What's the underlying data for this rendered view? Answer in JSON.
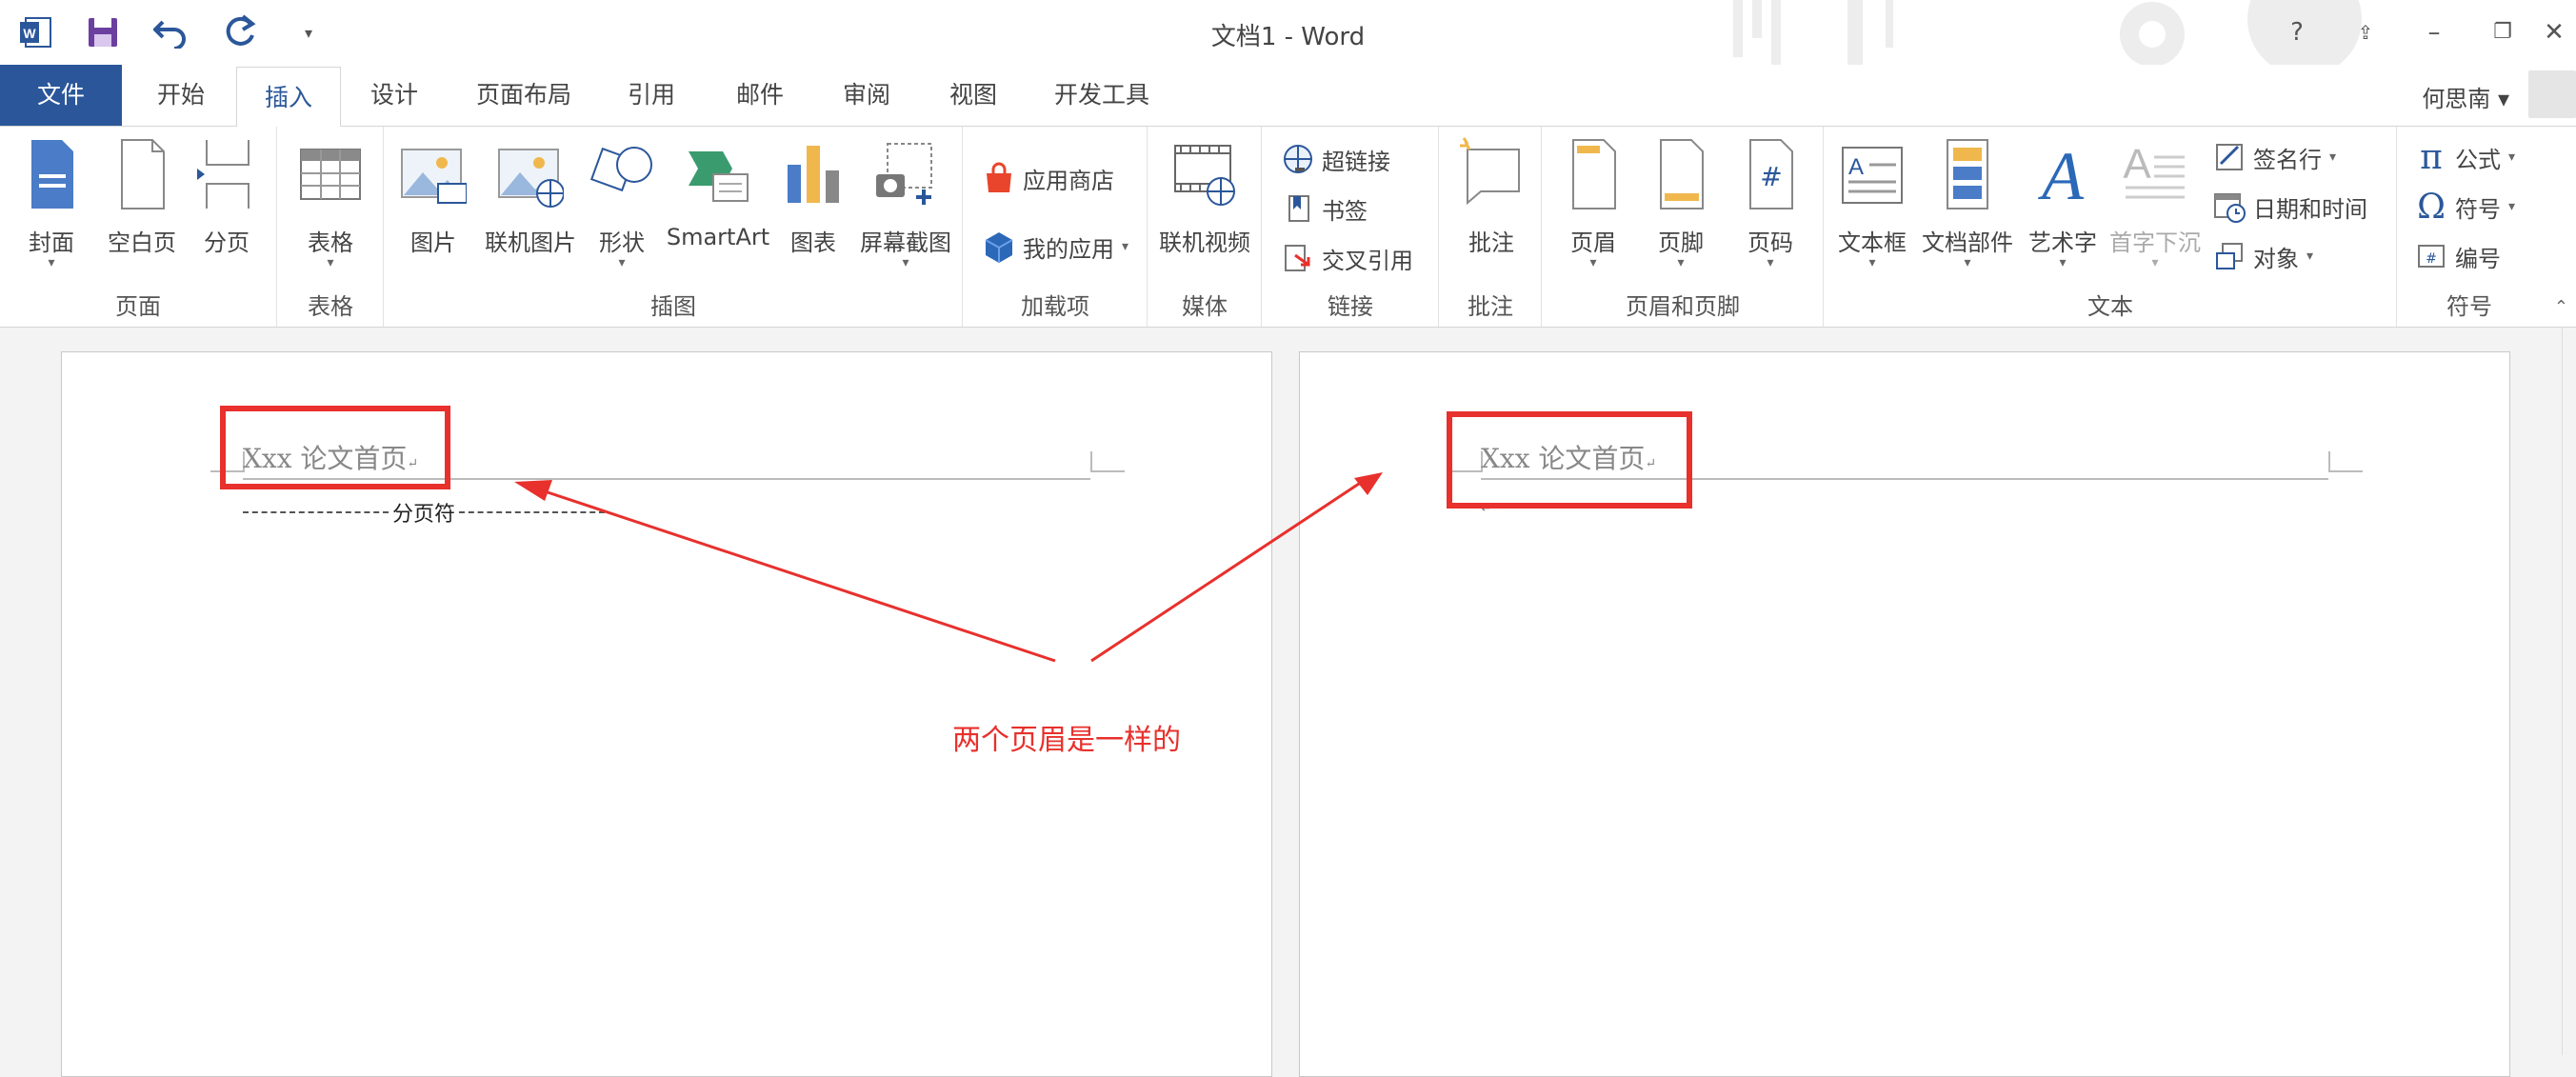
{
  "window": {
    "title": "文档1 - Word",
    "help": "?",
    "user": "何思南"
  },
  "tabs": [
    {
      "label": "文件"
    },
    {
      "label": "开始"
    },
    {
      "label": "插入"
    },
    {
      "label": "设计"
    },
    {
      "label": "页面布局"
    },
    {
      "label": "引用"
    },
    {
      "label": "邮件"
    },
    {
      "label": "审阅"
    },
    {
      "label": "视图"
    },
    {
      "label": "开发工具"
    }
  ],
  "ribbon": {
    "pages": {
      "label": "页面",
      "cover": "封面",
      "blank": "空白页",
      "break": "分页"
    },
    "tables": {
      "label": "表格",
      "table": "表格"
    },
    "illustrations": {
      "label": "插图",
      "picture": "图片",
      "online_picture": "联机图片",
      "shapes": "形状",
      "smartart": "SmartArt",
      "chart": "图表",
      "screenshot": "屏幕截图"
    },
    "addins": {
      "label": "加载项",
      "store": "应用商店",
      "myapps": "我的应用"
    },
    "media": {
      "label": "媒体",
      "video": "联机视频"
    },
    "links": {
      "label": "链接",
      "hyperlink": "超链接",
      "bookmark": "书签",
      "crossref": "交叉引用"
    },
    "comments": {
      "label": "批注",
      "comment": "批注"
    },
    "headerfooter": {
      "label": "页眉和页脚",
      "header": "页眉",
      "footer": "页脚",
      "pagenum": "页码"
    },
    "text": {
      "label": "文本",
      "textbox": "文本框",
      "quickparts": "文档部件",
      "wordart": "艺术字",
      "dropcap": "首字下沉",
      "sigline": "签名行",
      "datetime": "日期和时间",
      "object": "对象"
    },
    "symbols": {
      "label": "符号",
      "equation": "公式",
      "symbol": "符号",
      "number": "编号"
    }
  },
  "document": {
    "page1": {
      "header": "Xxx 论文首页",
      "page_break": "分页符"
    },
    "page2": {
      "header": "Xxx 论文首页"
    },
    "annotation": "两个页眉是一样的"
  },
  "colors": {
    "accent": "#2b579a",
    "annotation_red": "#e8302c"
  }
}
